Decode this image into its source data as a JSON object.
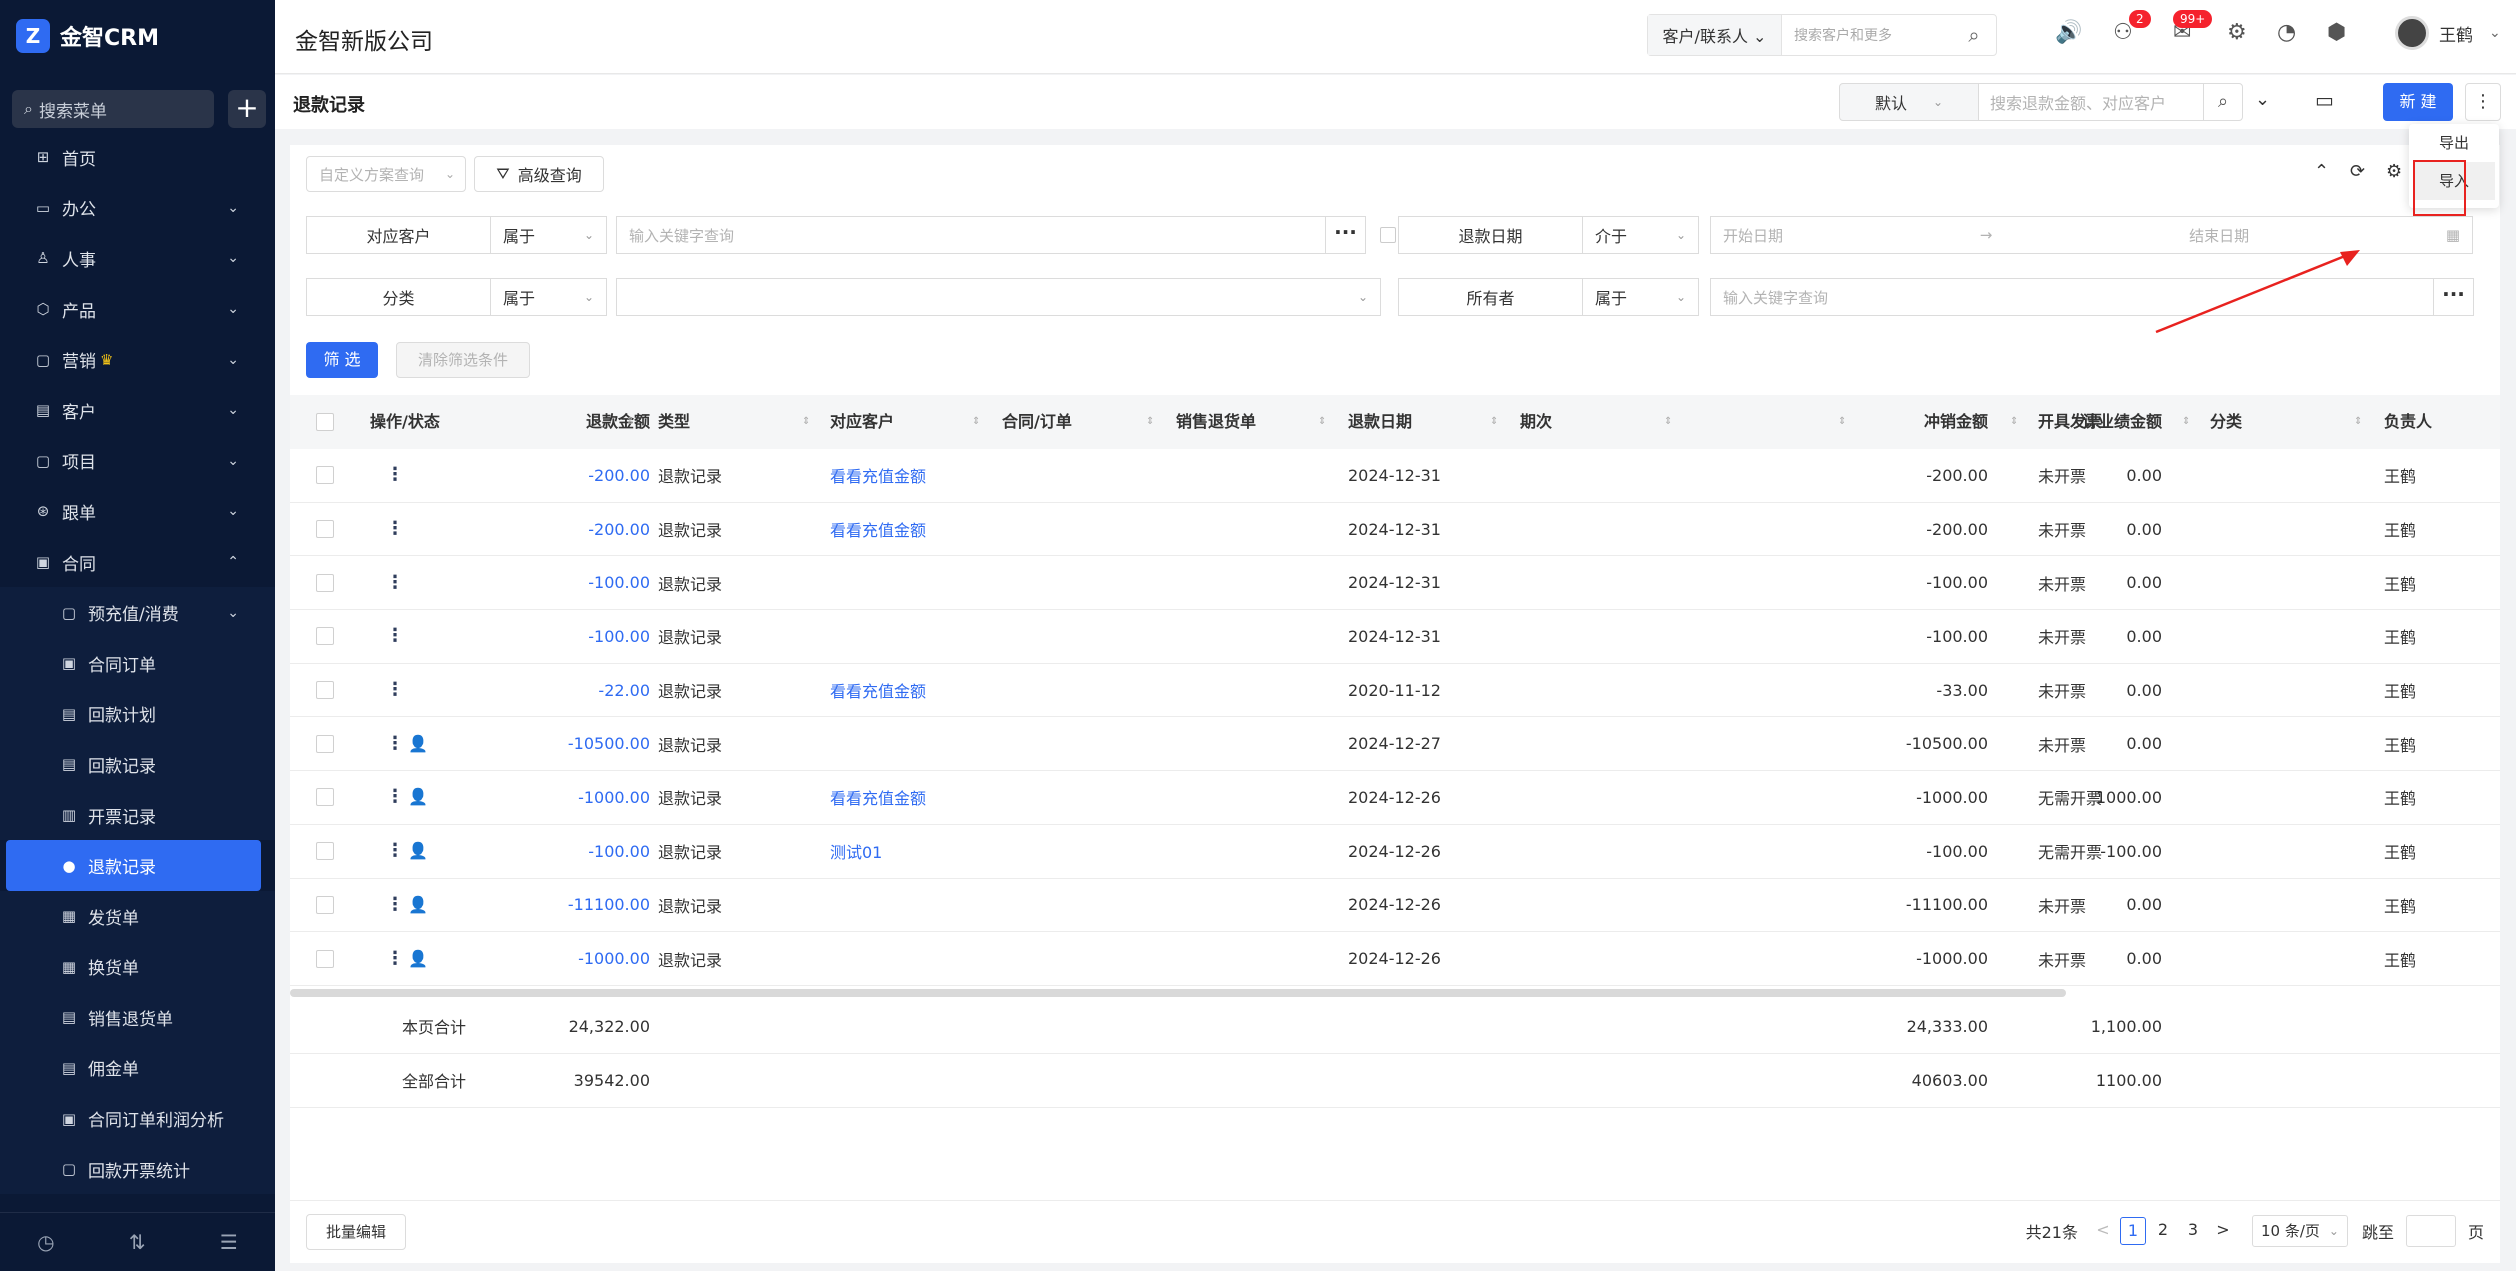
{
  "sidebar": {
    "logo_text": "金智CRM",
    "logo_mark": "Z",
    "search_placeholder": "搜索菜单",
    "add_label": "+",
    "items": [
      {
        "label": "首页",
        "icon": "home-icon",
        "glyph": "⊞",
        "chevron": ""
      },
      {
        "label": "办公",
        "icon": "office-icon",
        "glyph": "▭",
        "chevron": "⌄"
      },
      {
        "label": "人事",
        "icon": "people-icon",
        "glyph": "♙",
        "chevron": "⌄"
      },
      {
        "label": "产品",
        "icon": "product-icon",
        "glyph": "⬡",
        "chevron": "⌄"
      },
      {
        "label": "营销",
        "icon": "marketing-icon",
        "glyph": "▢",
        "chevron": "⌄",
        "crown": "♛"
      },
      {
        "label": "客户",
        "icon": "customer-icon",
        "glyph": "▤",
        "chevron": "⌄"
      },
      {
        "label": "项目",
        "icon": "project-icon",
        "glyph": "▢",
        "chevron": "⌄"
      },
      {
        "label": "跟单",
        "icon": "follow-icon",
        "glyph": "⊛",
        "chevron": "⌄"
      },
      {
        "label": "合同",
        "icon": "contract-icon",
        "glyph": "▣",
        "chevron": "⌃"
      }
    ],
    "sub_items": [
      {
        "label": "预充值/消费",
        "glyph": "▢",
        "chevron": "⌄"
      },
      {
        "label": "合同订单",
        "glyph": "▣",
        "chevron": ""
      },
      {
        "label": "回款计划",
        "glyph": "▤",
        "chevron": ""
      },
      {
        "label": "回款记录",
        "glyph": "▤",
        "chevron": ""
      },
      {
        "label": "开票记录",
        "glyph": "▥",
        "chevron": ""
      },
      {
        "label": "退款记录",
        "glyph": "●",
        "chevron": "",
        "active": true
      },
      {
        "label": "发货单",
        "glyph": "▦",
        "chevron": ""
      },
      {
        "label": "换货单",
        "glyph": "▦",
        "chevron": ""
      },
      {
        "label": "销售退货单",
        "glyph": "▤",
        "chevron": ""
      },
      {
        "label": "佣金单",
        "glyph": "▤",
        "chevron": ""
      },
      {
        "label": "合同订单利润分析",
        "glyph": "▣",
        "chevron": ""
      },
      {
        "label": "回款开票统计",
        "glyph": "▢",
        "chevron": ""
      }
    ],
    "bottom_icons": [
      "◷",
      "⇅",
      "☰"
    ]
  },
  "topbar": {
    "company": "金智新版公司",
    "search_scope": "客户/联系人 ⌄",
    "search_placeholder": "搜索客户和更多",
    "badge_task": "2",
    "badge_msg": "99+",
    "user_name": "王鹤",
    "icons": {
      "speaker": "🔊",
      "task": "⚇",
      "mail": "✉",
      "gear": "⚙",
      "chart": "◔",
      "cube": "⬢"
    }
  },
  "pagebar": {
    "title": "退款记录",
    "view_default": "默认",
    "search_placeholder": "搜索退款金额、对应客户",
    "new_label": "新 建",
    "more": "⋮"
  },
  "dropdown": {
    "export": "导出",
    "import": "导入"
  },
  "filters": {
    "custom_query": "自定义方案查询",
    "advanced": "高级查询",
    "row1": {
      "left_label": "对应客户",
      "left_op": "属于",
      "left_placeholder": "输入关键字查询",
      "right_label": "退款日期",
      "right_op": "介于",
      "start_placeholder": "开始日期",
      "arrow": "→",
      "end_placeholder": "结束日期"
    },
    "row2": {
      "left_label": "分类",
      "left_op": "属于",
      "right_label": "所有者",
      "right_op": "属于",
      "right_placeholder": "输入关键字查询"
    },
    "filter_btn": "筛 选",
    "clear_btn": "清除筛选条件"
  },
  "table": {
    "headers": [
      "操作/状态",
      "退款金额",
      "类型",
      "对应客户",
      "合同/订单",
      "销售退货单",
      "退款日期",
      "期次",
      "冲销金额",
      "计业绩金额",
      "开具发票",
      "分类",
      "负责人"
    ],
    "rows": [
      {
        "amount": "-200.00",
        "type": "退款记录",
        "customer": "看看充值金额",
        "date": "2024-12-31",
        "writeoff": "-200.00",
        "perf": "0.00",
        "invoice": "未开票",
        "owner": "王鹤",
        "person": false
      },
      {
        "amount": "-200.00",
        "type": "退款记录",
        "customer": "看看充值金额",
        "date": "2024-12-31",
        "writeoff": "-200.00",
        "perf": "0.00",
        "invoice": "未开票",
        "owner": "王鹤",
        "person": false
      },
      {
        "amount": "-100.00",
        "type": "退款记录",
        "customer": "",
        "date": "2024-12-31",
        "writeoff": "-100.00",
        "perf": "0.00",
        "invoice": "未开票",
        "owner": "王鹤",
        "person": false
      },
      {
        "amount": "-100.00",
        "type": "退款记录",
        "customer": "",
        "date": "2024-12-31",
        "writeoff": "-100.00",
        "perf": "0.00",
        "invoice": "未开票",
        "owner": "王鹤",
        "person": false
      },
      {
        "amount": "-22.00",
        "type": "退款记录",
        "customer": "看看充值金额",
        "date": "2020-11-12",
        "writeoff": "-33.00",
        "perf": "0.00",
        "invoice": "未开票",
        "owner": "王鹤",
        "person": false
      },
      {
        "amount": "-10500.00",
        "type": "退款记录",
        "customer": "",
        "date": "2024-12-27",
        "writeoff": "-10500.00",
        "perf": "0.00",
        "invoice": "未开票",
        "owner": "王鹤",
        "person": true
      },
      {
        "amount": "-1000.00",
        "type": "退款记录",
        "customer": "看看充值金额",
        "date": "2024-12-26",
        "writeoff": "-1000.00",
        "perf": "-1000.00",
        "invoice": "无需开票",
        "owner": "王鹤",
        "person": true
      },
      {
        "amount": "-100.00",
        "type": "退款记录",
        "customer": "测试01",
        "date": "2024-12-26",
        "writeoff": "-100.00",
        "perf": "-100.00",
        "invoice": "无需开票",
        "owner": "王鹤",
        "person": true
      },
      {
        "amount": "-11100.00",
        "type": "退款记录",
        "customer": "",
        "date": "2024-12-26",
        "writeoff": "-11100.00",
        "perf": "0.00",
        "invoice": "未开票",
        "owner": "王鹤",
        "person": true
      },
      {
        "amount": "-1000.00",
        "type": "退款记录",
        "customer": "",
        "date": "2024-12-26",
        "writeoff": "-1000.00",
        "perf": "0.00",
        "invoice": "未开票",
        "owner": "王鹤",
        "person": true
      }
    ],
    "page_total": {
      "label": "本页合计",
      "amount": "24,322.00",
      "writeoff": "24,333.00",
      "perf": "1,100.00"
    },
    "all_total": {
      "label": "全部合计",
      "amount": "39542.00",
      "writeoff": "40603.00",
      "perf": "1100.00"
    }
  },
  "footer": {
    "batch_edit": "批量编辑",
    "total": "共21条",
    "prev": "<",
    "pages": [
      "1",
      "2",
      "3"
    ],
    "next": ">",
    "page_size": "10 条/页",
    "jump_label": "跳至",
    "page_suffix": "页"
  },
  "colors": {
    "accent": "#2f6bf2",
    "sidebar": "#0b1935",
    "highlight_box": "#e8221f"
  }
}
